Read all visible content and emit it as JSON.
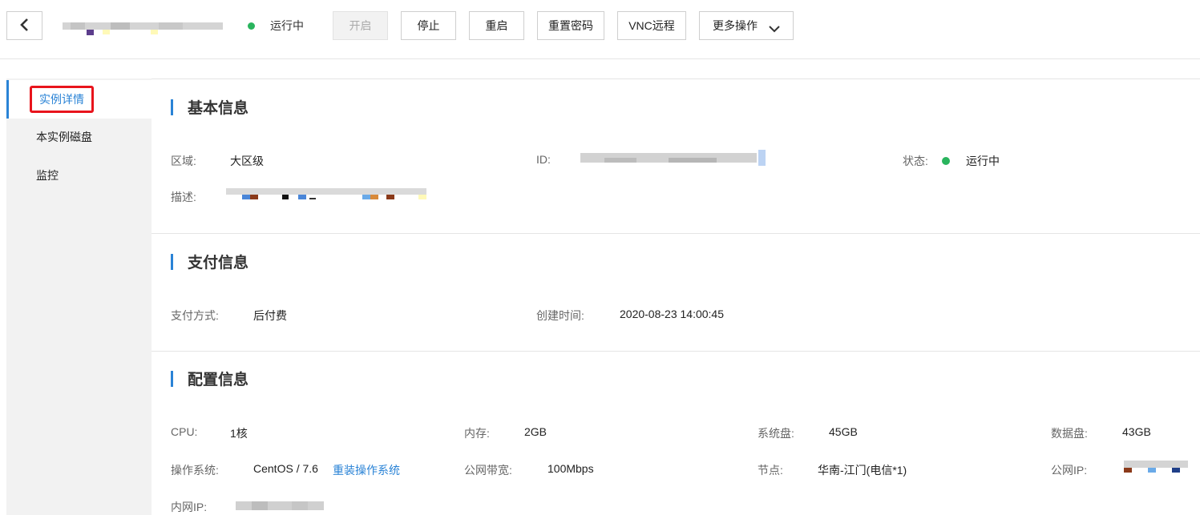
{
  "header": {
    "status_text": "运行中",
    "status_color": "#29b45d",
    "buttons": {
      "start": "开启",
      "stop": "停止",
      "restart": "重启",
      "reset_password": "重置密码",
      "vnc": "VNC远程",
      "more": "更多操作"
    },
    "back_icon": "chevron-left-icon",
    "more_icon": "chevron-down-icon"
  },
  "sidebar": {
    "items": [
      {
        "label": "实例详情"
      },
      {
        "label": "本实例磁盘"
      },
      {
        "label": "监控"
      }
    ]
  },
  "basic": {
    "title": "基本信息",
    "region_label": "区域:",
    "region_value": "大区级",
    "id_label": "ID:",
    "status_label": "状态:",
    "status_value": "运行中",
    "desc_label": "描述:"
  },
  "payment": {
    "title": "支付信息",
    "method_label": "支付方式:",
    "method_value": "后付费",
    "created_label": "创建时间:",
    "created_value": "2020-08-23 14:00:45"
  },
  "config": {
    "title": "配置信息",
    "cpu_label": "CPU:",
    "cpu_value": "1核",
    "mem_label": "内存:",
    "mem_value": "2GB",
    "sysdisk_label": "系统盘:",
    "sysdisk_value": "45GB",
    "datadisk_label": "数据盘:",
    "datadisk_value": "43GB",
    "os_label": "操作系统:",
    "os_value": "CentOS / 7.6",
    "reinstall_link": "重装操作系统",
    "bandwidth_label": "公网带宽:",
    "bandwidth_value": "100Mbps",
    "node_label": "节点:",
    "node_value": "华南-江门(电信*1)",
    "public_ip_label": "公网IP:",
    "private_ip_label": "内网IP:"
  },
  "colors": {
    "accent": "#2a83d6",
    "highlight_box": "#e8141c",
    "running": "#29b45d"
  }
}
